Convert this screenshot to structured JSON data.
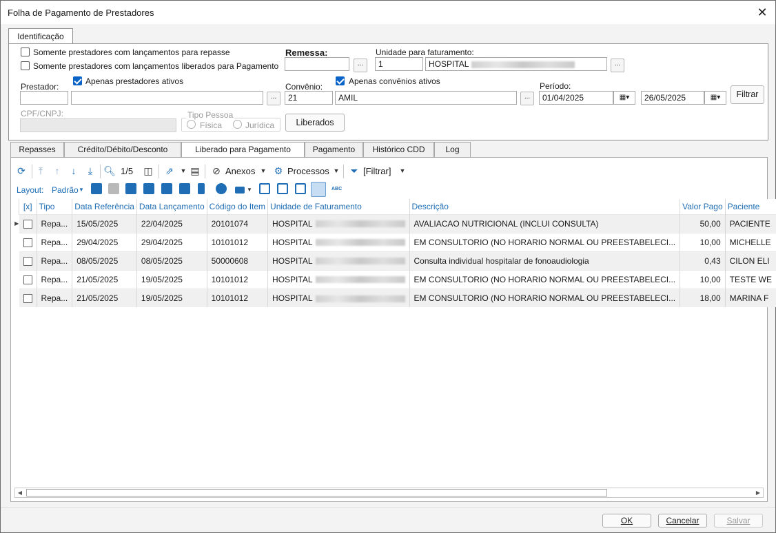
{
  "window": {
    "title": "Folha de Pagamento de Prestadores",
    "close": "✕"
  },
  "top_tab": "Identificação",
  "filters": {
    "opt1": "Somente prestadores com lançamentos para repasse",
    "opt2": "Somente prestadores com lançamentos liberados para Pagamento",
    "remessa_label": "Remessa:",
    "remessa_value": "",
    "unidade_label": "Unidade para faturamento:",
    "unidade_code": "1",
    "unidade_name": "HOSPITAL",
    "prestador_label": "Prestador:",
    "apenas_prestadores": "Apenas prestadores ativos",
    "prestador_code": "",
    "prestador_name": "",
    "convenio_label": "Convênio:",
    "apenas_convenios": "Apenas convênios ativos",
    "convenio_code": "21",
    "convenio_name": "AMIL",
    "periodo_label": "Período:",
    "periodo_inicio": "01/04/2025",
    "periodo_fim": "26/05/2025",
    "filtrar": "Filtrar",
    "cpf_label": "CPF/CNPJ:",
    "tipo_pessoa_label": "Tipo Pessoa",
    "fisica": "Física",
    "juridica": "Jurídica",
    "liberados": "Liberados",
    "dots": "..."
  },
  "tabs": [
    "Repasses",
    "Crédito/Débito/Desconto",
    "Liberado para Pagamento",
    "Pagamento",
    "Histórico CDD",
    "Log"
  ],
  "toolbar": {
    "page": "1/5",
    "anexos": "Anexos",
    "processos": "Processos",
    "filtrar": "[Filtrar]",
    "layout_label": "Layout:",
    "layout_value": "Padrão",
    "abc": "ABC"
  },
  "grid": {
    "columns": [
      "[x]",
      "Tipo",
      "Data Referência",
      "Data Lançamento",
      "Código do Item",
      "Unidade de Faturamento",
      "Descrição",
      "Valor Pago",
      "Paciente"
    ],
    "rows": [
      {
        "tipo": "Repa...",
        "ref": "15/05/2025",
        "lanc": "22/04/2025",
        "cod": "20101074",
        "unid": "HOSPITAL",
        "desc": "AVALIACAO NUTRICIONAL (INCLUI CONSULTA)",
        "valor": "50,00",
        "pac": "PACIENTE"
      },
      {
        "tipo": "Repa...",
        "ref": "29/04/2025",
        "lanc": "29/04/2025",
        "cod": "10101012",
        "unid": "HOSPITAL",
        "desc": "EM CONSULTORIO (NO HORARIO NORMAL OU PREESTABELECI...",
        "valor": "10,00",
        "pac": "MICHELLE"
      },
      {
        "tipo": "Repa...",
        "ref": "08/05/2025",
        "lanc": "08/05/2025",
        "cod": "50000608",
        "unid": "HOSPITAL",
        "desc": "Consulta individual hospitalar de fonoaudiologia",
        "valor": "0,43",
        "pac": "CILON ELI"
      },
      {
        "tipo": "Repa...",
        "ref": "21/05/2025",
        "lanc": "19/05/2025",
        "cod": "10101012",
        "unid": "HOSPITAL",
        "desc": "EM CONSULTORIO (NO HORARIO NORMAL OU PREESTABELECI...",
        "valor": "10,00",
        "pac": "TESTE WE"
      },
      {
        "tipo": "Repa...",
        "ref": "21/05/2025",
        "lanc": "19/05/2025",
        "cod": "10101012",
        "unid": "HOSPITAL",
        "desc": "EM CONSULTORIO (NO HORARIO NORMAL OU PREESTABELECI...",
        "valor": "18,00",
        "pac": "MARINA F"
      }
    ]
  },
  "footer": {
    "ok": "OK",
    "cancelar": "Cancelar",
    "salvar": "Salvar"
  }
}
